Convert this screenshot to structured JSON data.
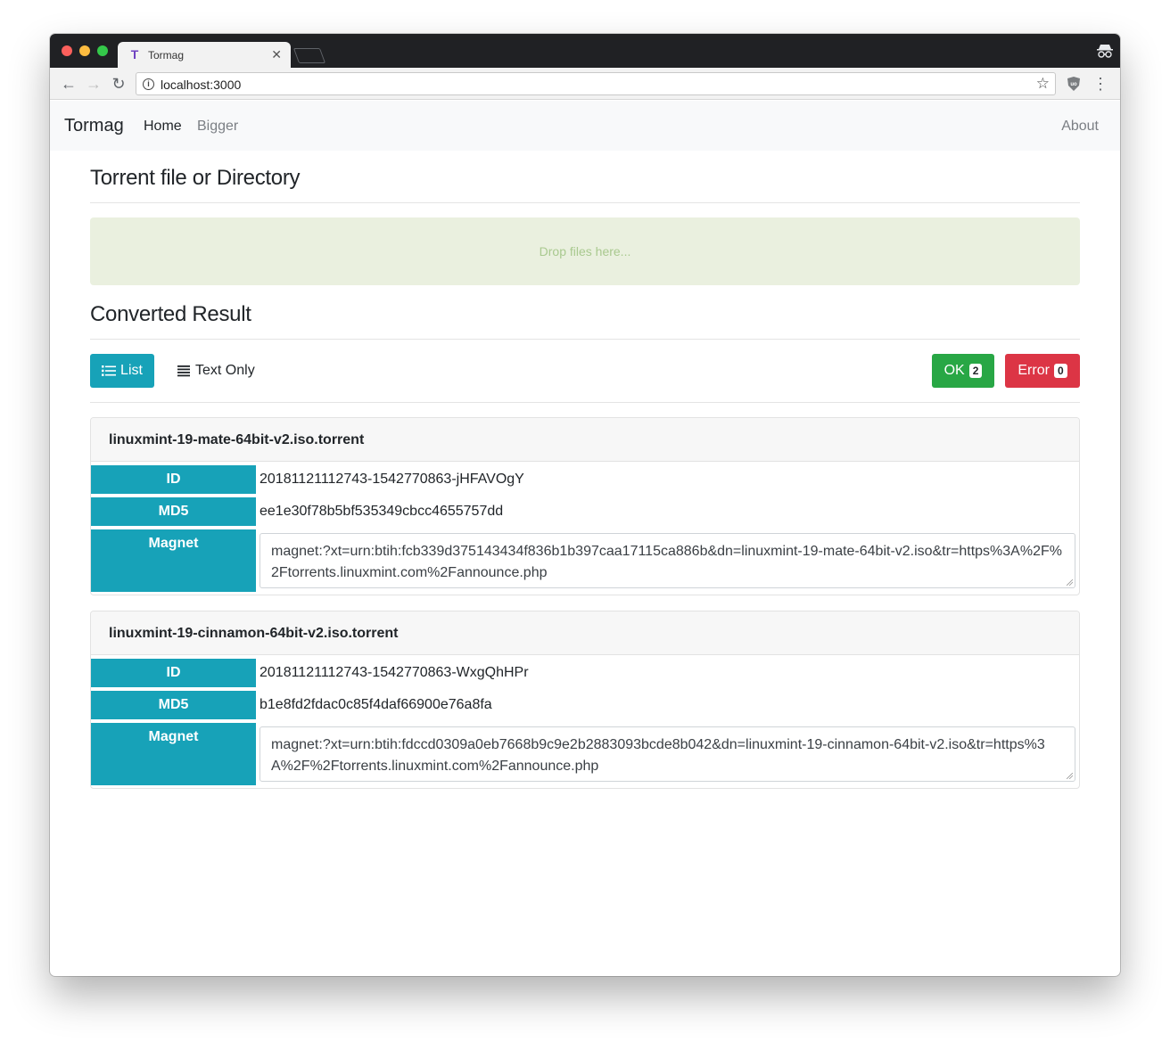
{
  "browser": {
    "tab_title": "Tormag",
    "favicon_letter": "T",
    "tab_close": "✕",
    "url": "localhost:3000"
  },
  "navbar": {
    "brand": "Tormag",
    "links": [
      "Home",
      "Bigger"
    ],
    "about": "About"
  },
  "upload": {
    "heading": "Torrent file or Directory",
    "dropzone_text": "Drop files here..."
  },
  "result": {
    "heading": "Converted Result",
    "list_button": "List",
    "text_only_button": "Text Only",
    "ok_label": "OK",
    "ok_count": "2",
    "error_label": "Error",
    "error_count": "0"
  },
  "field_labels": {
    "id": "ID",
    "md5": "MD5",
    "magnet": "Magnet"
  },
  "torrents": [
    {
      "filename": "linuxmint-19-mate-64bit-v2.iso.torrent",
      "id": "20181121112743-1542770863-jHFAVOgY",
      "md5": "ee1e30f78b5bf535349cbcc4655757dd",
      "magnet": "magnet:?xt=urn:btih:fcb339d375143434f836b1b397caa17115ca886b&dn=linuxmint-19-mate-64bit-v2.iso&tr=https%3A%2F%2Ftorrents.linuxmint.com%2Fannounce.php"
    },
    {
      "filename": "linuxmint-19-cinnamon-64bit-v2.iso.torrent",
      "id": "20181121112743-1542770863-WxgQhHPr",
      "md5": "b1e8fd2fdac0c85f4daf66900e76a8fa",
      "magnet": "magnet:?xt=urn:btih:fdccd0309a0eb7668b9c9e2b2883093bcde8b042&dn=linuxmint-19-cinnamon-64bit-v2.iso&tr=https%3A%2F%2Ftorrents.linuxmint.com%2Fannounce.php"
    }
  ],
  "colors": {
    "info": "#17a2b8",
    "success": "#28a745",
    "danger": "#dc3545",
    "dropzone_bg": "#eaf0df"
  }
}
